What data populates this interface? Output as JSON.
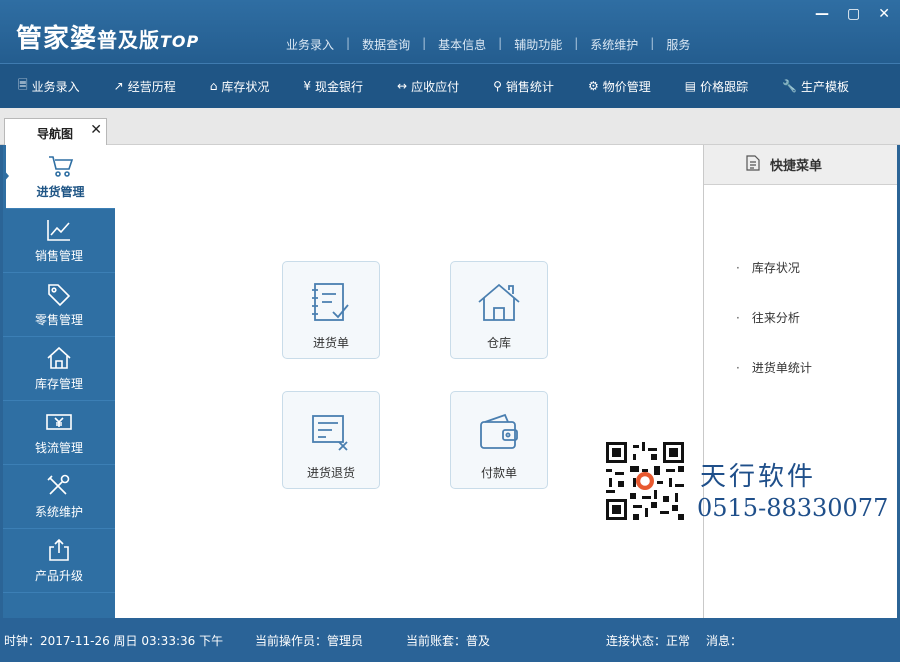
{
  "app": {
    "logo_main": "管家婆",
    "logo_sub": "普及版",
    "logo_top": "TOP"
  },
  "top_menu": [
    "业务录入",
    "数据查询",
    "基本信息",
    "辅助功能",
    "系统维护",
    "服务"
  ],
  "window_controls": [
    "minimize-icon",
    "maximize-icon",
    "close-icon"
  ],
  "toolbar": [
    {
      "label": "业务录入",
      "icon": "document-icon"
    },
    {
      "label": "经营历程",
      "icon": "trend-icon"
    },
    {
      "label": "库存状况",
      "icon": "home-icon"
    },
    {
      "label": "现金银行",
      "icon": "yen-icon"
    },
    {
      "label": "应收应付",
      "icon": "exchange-icon"
    },
    {
      "label": "销售统计",
      "icon": "search-icon"
    },
    {
      "label": "物价管理",
      "icon": "gear-icon"
    },
    {
      "label": "价格跟踪",
      "icon": "bar-chart-icon"
    },
    {
      "label": "生产模板",
      "icon": "wrench-icon"
    }
  ],
  "tab": {
    "label": "导航图",
    "close": "✕"
  },
  "sidebar": [
    {
      "label": "进货管理",
      "icon": "cart-icon",
      "active": true
    },
    {
      "label": "销售管理",
      "icon": "trend-icon"
    },
    {
      "label": "零售管理",
      "icon": "tag-icon"
    },
    {
      "label": "库存管理",
      "icon": "home-icon"
    },
    {
      "label": "钱流管理",
      "icon": "money-icon"
    },
    {
      "label": "系统维护",
      "icon": "tools-icon"
    },
    {
      "label": "产品升级",
      "icon": "upload-icon"
    }
  ],
  "cards": [
    {
      "label": "进货单",
      "icon": "checklist-icon"
    },
    {
      "label": "仓库",
      "icon": "warehouse-icon"
    },
    {
      "label": "进货退货",
      "icon": "return-icon"
    },
    {
      "label": "付款单",
      "icon": "wallet-icon"
    }
  ],
  "quick_menu": {
    "title": "快捷菜单",
    "items": [
      "库存状况",
      "往来分析",
      "进货单统计"
    ]
  },
  "promo": {
    "name": "天行软件",
    "phone": "0515-88330077"
  },
  "status": {
    "clock": "时钟：2017-11-26 周日 03:33:36 下午",
    "operator": "当前操作员：管理员",
    "account": "当前账套：普及",
    "connection": "连接状态：正常",
    "message": "消息："
  }
}
